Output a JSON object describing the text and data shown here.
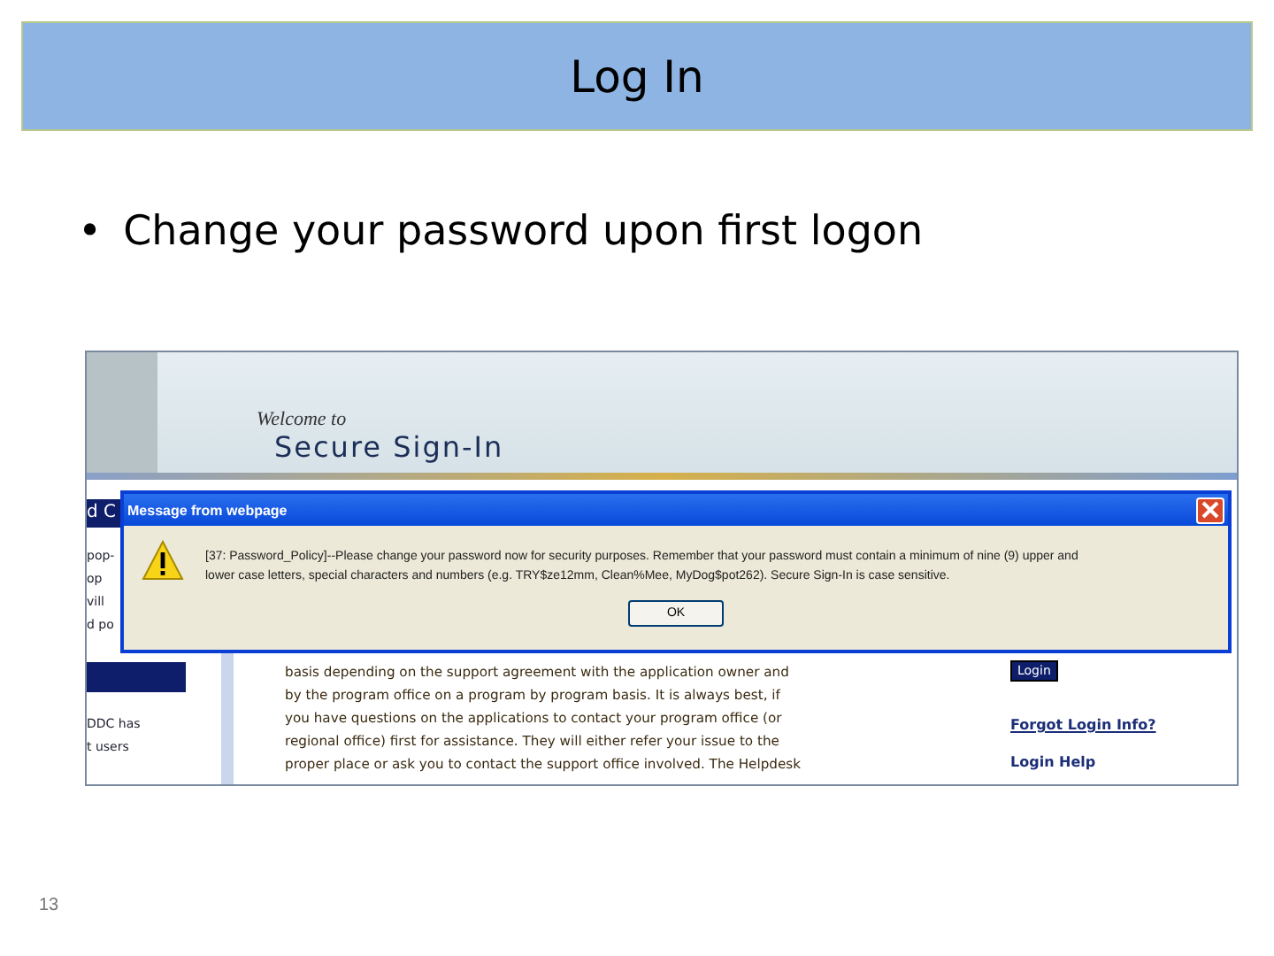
{
  "slide": {
    "title": "Log In",
    "bullet_mark": "•",
    "bullets": [
      "Change your password upon first logon"
    ],
    "page_number": "13"
  },
  "screenshot": {
    "welcome": "Welcome to",
    "heading": "Secure Sign-In",
    "left_column": [
      {
        "kind": "bar",
        "text": "d C"
      },
      {
        "kind": "text",
        "text": "pop-"
      },
      {
        "kind": "text",
        "text": "op"
      },
      {
        "kind": "text",
        "text": "vill"
      },
      {
        "kind": "text",
        "text": "d po"
      },
      {
        "kind": "bar"
      },
      {
        "kind": "text",
        "text": "DDC has"
      },
      {
        "kind": "text",
        "text": "t users"
      }
    ],
    "body_lines": [
      "basis depending on the support agreement with the application owner and",
      "by the program office on a program by program basis. It is always best, if",
      "you have questions on the applications to contact your program office (or",
      "regional office) first for assistance. They will either refer your issue to the",
      "proper place or ask you to contact the support office involved. The Helpdesk"
    ],
    "login_button": "Login",
    "links": [
      "Forgot Login Info?",
      "Login Help"
    ],
    "dialog": {
      "title": "Message from webpage",
      "message": [
        "[37: Password_Policy]--Please change your password now for security purposes. Remember that your password must contain a minimum of nine (9) upper and",
        "lower case letters, special characters and numbers (e.g. TRY$ze12mm, Clean%Mee, MyDog$pot262). Secure Sign-In is case sensitive."
      ],
      "button": "OK"
    }
  }
}
